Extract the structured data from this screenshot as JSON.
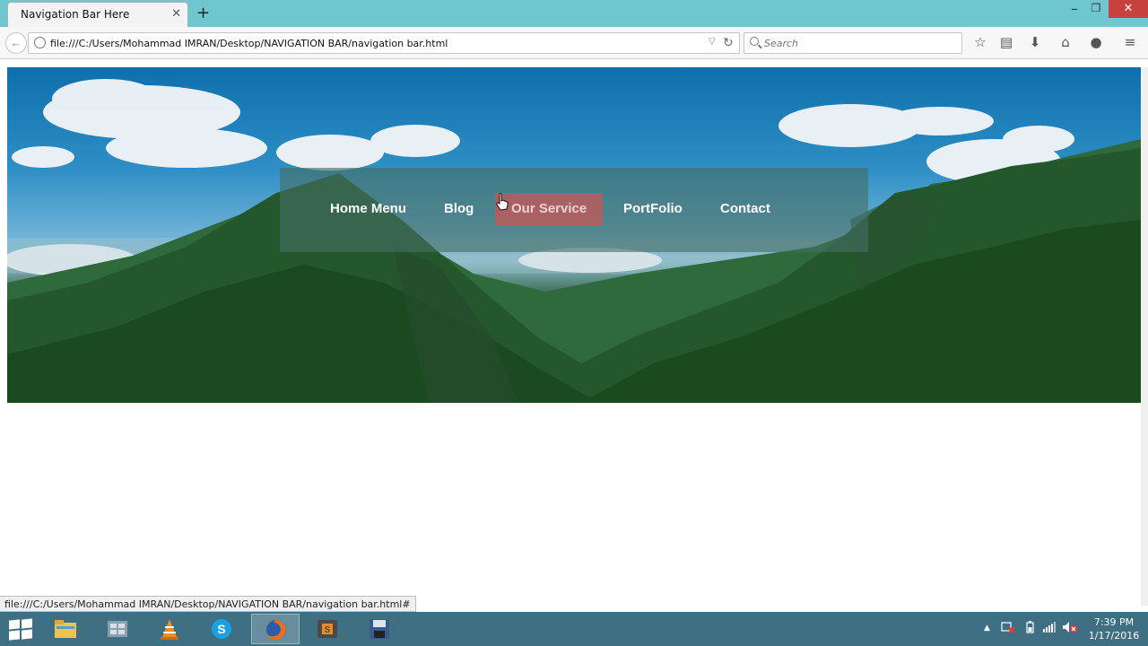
{
  "browser": {
    "tab_title": "Navigation Bar Here",
    "tab_close": "✕",
    "new_tab": "+",
    "window_minimize": "–",
    "window_restore": "❐",
    "window_close": "✕",
    "back_icon": "←",
    "url": "file:///C:/Users/Mohammad IMRAN/Desktop/NAVIGATION BAR/navigation bar.html",
    "url_dropdown": "▽",
    "reload": "↻",
    "search_placeholder": "Search",
    "toolbar_icons": {
      "bookmark": "☆",
      "reading_list": "▤",
      "downloads": "⬇",
      "home": "⌂",
      "chat": "●",
      "menu": "≡"
    }
  },
  "page": {
    "nav_items": [
      {
        "label": "Home Menu",
        "active": false
      },
      {
        "label": "Blog",
        "active": false
      },
      {
        "label": "Our Service",
        "active": true
      },
      {
        "label": "PortFolio",
        "active": false
      },
      {
        "label": "Contact",
        "active": false
      }
    ],
    "status_url": "file:///C:/Users/Mohammad IMRAN/Desktop/NAVIGATION BAR/navigation bar.html#"
  },
  "taskbar": {
    "apps": [
      {
        "name": "file-explorer",
        "active": false
      },
      {
        "name": "network-app",
        "active": false
      },
      {
        "name": "vlc",
        "active": false
      },
      {
        "name": "skype",
        "active": false
      },
      {
        "name": "firefox",
        "active": true
      },
      {
        "name": "sublime-text",
        "active": false
      },
      {
        "name": "save-app",
        "active": false
      }
    ],
    "tray": {
      "chevron": "▲"
    },
    "time": "7:39 PM",
    "date": "1/17/2016"
  },
  "colors": {
    "titlebar": "#6ec6cf",
    "taskbar": "#3e6f82",
    "nav_overlay": "#466e64",
    "nav_active": "#cd5555",
    "close_button": "#c7413e"
  }
}
